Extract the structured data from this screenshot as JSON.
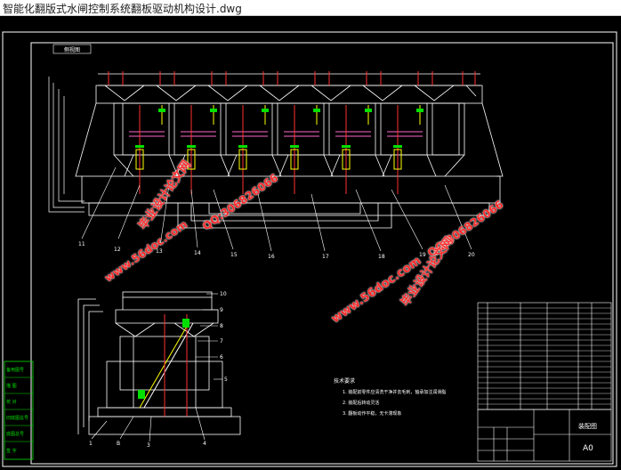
{
  "window": {
    "title": "智能化翻版式水闸控制系统翻板驱动机构设计.dwg"
  },
  "drawing": {
    "tag": "侧视图",
    "top_part_numbers": [
      "11",
      "12",
      "13",
      "14",
      "15",
      "16",
      "17",
      "18",
      "19",
      "20"
    ],
    "side_part_numbers": [
      "10",
      "9",
      "8",
      "7",
      "6",
      "5"
    ],
    "bottom_part_numbers": [
      "1",
      "B",
      "3",
      "4"
    ],
    "notes_title": "技术要求",
    "notes": [
      "1. 装配前零件应清洗干净并去毛刺，轴承加注润滑脂",
      "2. 装配后转动灵活",
      "3. 翻板动作平稳，无卡滞现象"
    ],
    "sheet_size": "A0",
    "drawing_name": "装配图",
    "left_stamp_rows": [
      "备用图号",
      "描   图",
      "校   对",
      "旧底图总号",
      "底图总号",
      "签   字"
    ]
  },
  "watermarks": [
    {
      "text": "毕业设计论文网"
    },
    {
      "text": "www.56doc.com"
    },
    {
      "text": "QQ:306826066"
    },
    {
      "text": "www.56doc.com"
    },
    {
      "text": "QQ:306826066"
    },
    {
      "text": "毕业设计论文网"
    }
  ],
  "colors": {
    "background": "#000000",
    "lines": "#ffffff",
    "accent": "#ff3030",
    "green": "#00e000",
    "yellow": "#ffff00",
    "watermark": "#ff2a2a"
  }
}
